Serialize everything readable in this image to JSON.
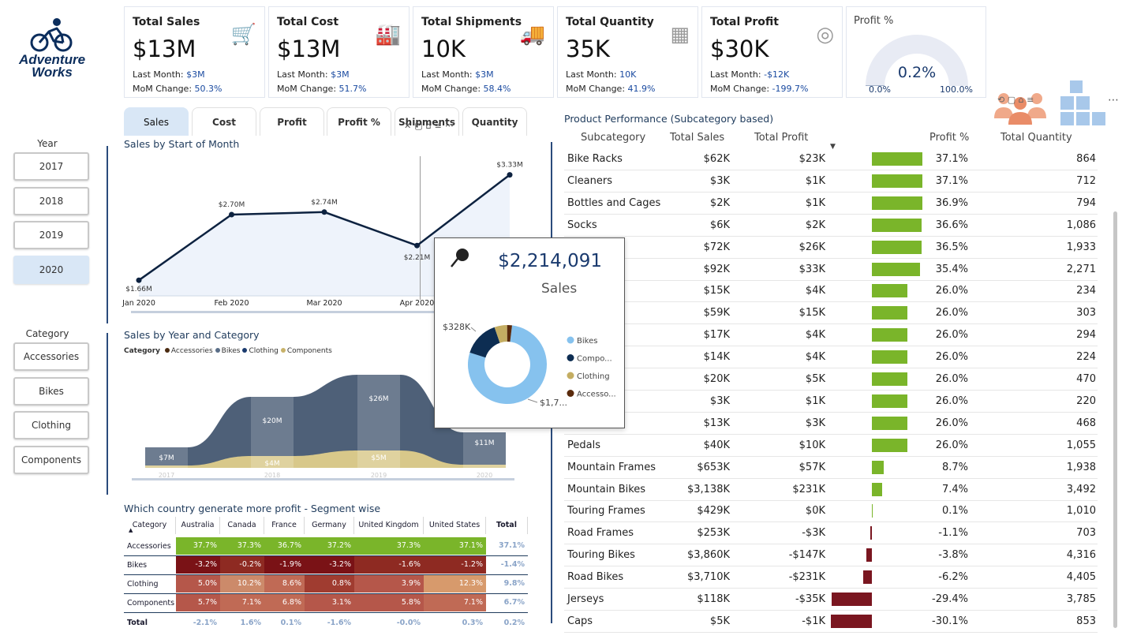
{
  "brand": {
    "line1": "Adventure",
    "line2": "Works"
  },
  "slicers": {
    "year_label": "Year",
    "years": [
      "2017",
      "2018",
      "2019",
      "2020"
    ],
    "category_label": "Category",
    "categories": [
      "Accessories",
      "Bikes",
      "Clothing",
      "Components"
    ]
  },
  "kpis": [
    {
      "title": "Total Sales",
      "value": "$13M",
      "last": "$3M",
      "mom": "50.3%",
      "icon": "cart-icon"
    },
    {
      "title": "Total Cost",
      "value": "$13M",
      "last": "$3M",
      "mom": "51.7%",
      "icon": "factory-icon"
    },
    {
      "title": "Total Shipments",
      "value": "10K",
      "last": "$3M",
      "mom": "58.4%",
      "icon": "truck-icon"
    },
    {
      "title": "Total Quantity",
      "value": "35K",
      "last": "10K",
      "mom": "41.9%",
      "icon": "boxes-icon"
    },
    {
      "title": "Total Profit",
      "value": "$30K",
      "last": "-$12K",
      "mom": "-199.7%",
      "icon": "coins-icon"
    }
  ],
  "kpi_labels": {
    "last": "Last Month: ",
    "mom": "MoM Change: "
  },
  "gauge": {
    "title": "Profit %",
    "value": "0.2%",
    "min": "0.0%",
    "max": "100.0%",
    "fraction": 0.002
  },
  "tabs": [
    "Sales",
    "Cost",
    "Profit",
    "Profit %",
    "Shipments",
    "Quantity"
  ],
  "line_chart": {
    "title": "Sales by Start of Month"
  },
  "area_chart": {
    "title": "Sales by Year and Category",
    "legend_title": "Category"
  },
  "matrix": {
    "title": "Which country generate more profit - Segment wise",
    "columns": [
      "Category",
      "Australia",
      "Canada",
      "France",
      "Germany",
      "United Kingdom",
      "United States",
      "Total"
    ],
    "rows": [
      {
        "cat": "Accessories",
        "vals": [
          "37.7%",
          "37.3%",
          "36.7%",
          "37.2%",
          "37.3%",
          "37.1%"
        ],
        "total": "37.1%"
      },
      {
        "cat": "Bikes",
        "vals": [
          "-3.2%",
          "-0.2%",
          "-1.9%",
          "-3.2%",
          "-1.6%",
          "-1.2%"
        ],
        "total": "-1.4%"
      },
      {
        "cat": "Clothing",
        "vals": [
          "5.0%",
          "10.2%",
          "8.6%",
          "0.8%",
          "3.9%",
          "12.3%"
        ],
        "total": "9.8%"
      },
      {
        "cat": "Components",
        "vals": [
          "5.7%",
          "7.1%",
          "6.8%",
          "3.1%",
          "5.8%",
          "7.1%"
        ],
        "total": "6.7%"
      }
    ],
    "total_row": {
      "cat": "Total",
      "vals": [
        "-2.1%",
        "1.6%",
        "0.1%",
        "-1.6%",
        "-0.0%",
        "0.3%"
      ],
      "total": "0.2%"
    },
    "colors": {
      "high": "#7ab52a",
      "dark_red": "#7a1216",
      "red": "#8e2a22",
      "mid": "#b5574a",
      "light": "#c9836f",
      "lighter": "#d9a07f"
    }
  },
  "product": {
    "title": "Product Performance (Subcategory based)",
    "headers": [
      "Subcategory",
      "Total Sales",
      "Total Profit",
      "Profit %",
      "Total Quantity"
    ],
    "rows": [
      {
        "name": "Bike Racks",
        "sales": "$62K",
        "profit": "$23K",
        "pct": "37.1%",
        "qty": "864",
        "v": 37.1
      },
      {
        "name": "Cleaners",
        "sales": "$3K",
        "profit": "$1K",
        "pct": "37.1%",
        "qty": "712",
        "v": 37.1
      },
      {
        "name": "Bottles and Cages",
        "sales": "$2K",
        "profit": "$1K",
        "pct": "36.9%",
        "qty": "794",
        "v": 36.9
      },
      {
        "name": "Socks",
        "sales": "$6K",
        "profit": "$2K",
        "pct": "36.6%",
        "qty": "1,086",
        "v": 36.6
      },
      {
        "name": "",
        "sales": "$72K",
        "profit": "$26K",
        "pct": "36.5%",
        "qty": "1,933",
        "v": 36.5
      },
      {
        "name": "",
        "sales": "$92K",
        "profit": "$33K",
        "pct": "35.4%",
        "qty": "2,271",
        "v": 35.4
      },
      {
        "name": "",
        "sales": "$15K",
        "profit": "$4K",
        "pct": "26.0%",
        "qty": "234",
        "v": 26.0
      },
      {
        "name": "",
        "sales": "$59K",
        "profit": "$15K",
        "pct": "26.0%",
        "qty": "303",
        "v": 26.0
      },
      {
        "name": "",
        "sales": "$17K",
        "profit": "$4K",
        "pct": "26.0%",
        "qty": "294",
        "v": 26.0
      },
      {
        "name": "ckets",
        "sales": "$14K",
        "profit": "$4K",
        "pct": "26.0%",
        "qty": "224",
        "v": 26.0
      },
      {
        "name": "",
        "sales": "$20K",
        "profit": "$5K",
        "pct": "26.0%",
        "qty": "470",
        "v": 26.0
      },
      {
        "name": "",
        "sales": "$3K",
        "profit": "$1K",
        "pct": "26.0%",
        "qty": "220",
        "v": 26.0
      },
      {
        "name": "",
        "sales": "$13K",
        "profit": "$3K",
        "pct": "26.0%",
        "qty": "468",
        "v": 26.0
      },
      {
        "name": "Pedals",
        "sales": "$40K",
        "profit": "$10K",
        "pct": "26.0%",
        "qty": "1,055",
        "v": 26.0
      },
      {
        "name": "Mountain Frames",
        "sales": "$653K",
        "profit": "$57K",
        "pct": "8.7%",
        "qty": "1,938",
        "v": 8.7
      },
      {
        "name": "Mountain Bikes",
        "sales": "$3,138K",
        "profit": "$231K",
        "pct": "7.4%",
        "qty": "3,492",
        "v": 7.4
      },
      {
        "name": "Touring Frames",
        "sales": "$429K",
        "profit": "$0K",
        "pct": "0.1%",
        "qty": "1,010",
        "v": 0.1
      },
      {
        "name": "Road Frames",
        "sales": "$253K",
        "profit": "-$3K",
        "pct": "-1.1%",
        "qty": "703",
        "v": -1.1
      },
      {
        "name": "Touring Bikes",
        "sales": "$3,860K",
        "profit": "-$147K",
        "pct": "-3.8%",
        "qty": "4,316",
        "v": -3.8
      },
      {
        "name": "Road Bikes",
        "sales": "$3,710K",
        "profit": "-$231K",
        "pct": "-6.2%",
        "qty": "4,405",
        "v": -6.2
      },
      {
        "name": "Jerseys",
        "sales": "$118K",
        "profit": "-$35K",
        "pct": "-29.4%",
        "qty": "3,785",
        "v": -29.4
      },
      {
        "name": "Caps",
        "sales": "$5K",
        "profit": "-$1K",
        "pct": "-30.1%",
        "qty": "853",
        "v": -30.1
      }
    ],
    "colors": {
      "pos": "#7ab52a",
      "neg": "#7a1620"
    }
  },
  "tooltip": {
    "value": "$2,214,091",
    "label": "Sales",
    "slice_label": "$328K",
    "bottom_label": "$1,7...",
    "legend": [
      "Bikes",
      "Compo...",
      "Clothing",
      "Accesso..."
    ],
    "colors": [
      "#86c2ee",
      "#0d2d52",
      "#c4ad62",
      "#5a2a0c"
    ],
    "shares": [
      0.78,
      0.148,
      0.052,
      0.02
    ]
  },
  "chart_data": [
    {
      "type": "line",
      "title": "Sales by Start of Month",
      "categories": [
        "Jan 2020",
        "Feb 2020",
        "Mar 2020",
        "Apr 2020",
        "May 2020"
      ],
      "x_tick_labels": [
        "Jan 2020",
        "Feb 2020",
        "Mar 2020",
        "Apr 2020"
      ],
      "values": [
        1.66,
        2.7,
        2.74,
        2.21,
        3.33
      ],
      "labels": [
        "$1.66M",
        "$2.70M",
        "$2.74M",
        "$2.21M",
        "$3.33M"
      ],
      "ylim": [
        1.5,
        3.45
      ],
      "color": "#0d2240"
    },
    {
      "type": "area",
      "title": "Sales by Year and Category",
      "categories": [
        "2017",
        "2018",
        "2019",
        "2020"
      ],
      "legend": [
        "Accessories",
        "Bikes",
        "Clothing",
        "Components"
      ],
      "legend_colors": [
        "#4a2a10",
        "#5a6e88",
        "#1a3a6e",
        "#c8b26a"
      ],
      "total_labels": [
        "$7M",
        "$20M",
        "$26M",
        "$11M"
      ],
      "component_labels": [
        "",
        "$4M",
        "$5M",
        ""
      ]
    }
  ]
}
